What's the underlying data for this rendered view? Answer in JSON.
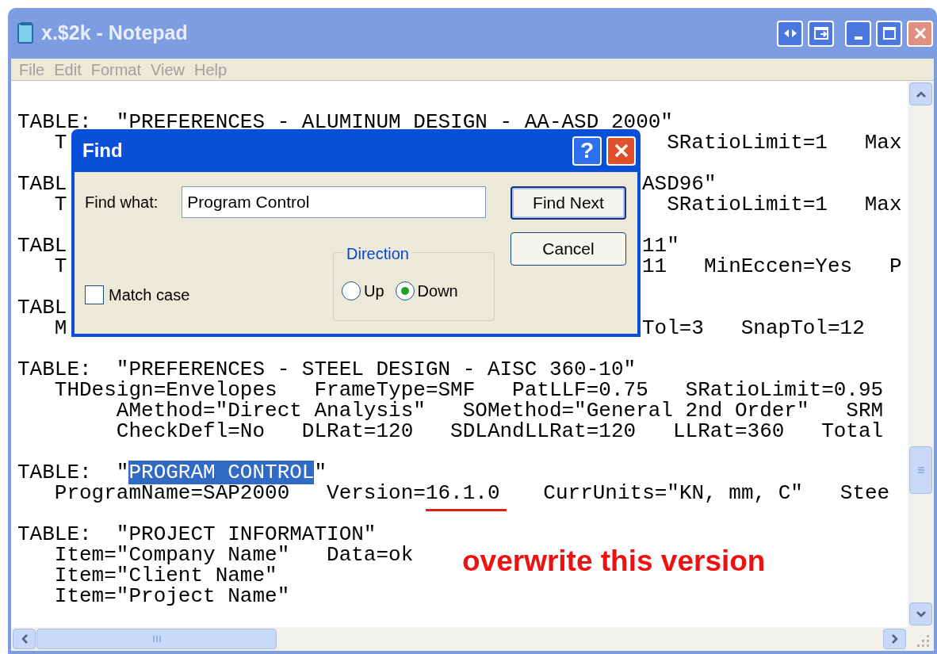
{
  "window": {
    "title": "x.$2k - Notepad"
  },
  "menu": [
    "File",
    "Edit",
    "Format",
    "View",
    "Help"
  ],
  "document": {
    "blocks": [
      {
        "lines": [
          {
            "segments": [
              {
                "kind": "plain",
                "text": "TABLE:  \"PREFERENCES - ALUMINUM DESIGN - AA-ASD 2000\""
              }
            ]
          },
          {
            "segments": [
              {
                "kind": "plain",
                "text": "   T"
              },
              {
                "kind": "far",
                "text": "  SRatioLimit=1   Max"
              }
            ]
          }
        ]
      },
      {
        "lines": [
          {
            "segments": [
              {
                "kind": "plain",
                "text": "TABL"
              },
              {
                "kind": "far",
                "text": "ASD96\""
              }
            ]
          },
          {
            "segments": [
              {
                "kind": "plain",
                "text": "   T"
              },
              {
                "kind": "far",
                "text": "  SRatioLimit=1   Max"
              }
            ]
          }
        ]
      },
      {
        "lines": [
          {
            "segments": [
              {
                "kind": "plain",
                "text": "TABL"
              },
              {
                "kind": "far",
                "text": "11\""
              }
            ]
          },
          {
            "segments": [
              {
                "kind": "plain",
                "text": "   T"
              },
              {
                "kind": "far",
                "text": "11   MinEccen=Yes   P"
              }
            ]
          }
        ]
      },
      {
        "lines": [
          {
            "segments": [
              {
                "kind": "plain",
                "text": "TABL"
              }
            ]
          },
          {
            "segments": [
              {
                "kind": "plain",
                "text": "   M"
              },
              {
                "kind": "far",
                "text": "Tol=3   SnapTol=12"
              }
            ]
          }
        ]
      },
      {
        "lines": [
          {
            "segments": [
              {
                "kind": "plain",
                "text": "TABLE:  \"PREFERENCES - STEEL DESIGN - AISC 360-10\""
              }
            ]
          },
          {
            "segments": [
              {
                "kind": "plain",
                "text": "   THDesign=Envelopes   FrameType=SMF   PatLLF=0.75   SRatioLimit=0.95"
              }
            ]
          },
          {
            "segments": [
              {
                "kind": "plain",
                "text": "        AMethod=\"Direct Analysis\"   SOMethod=\"General 2nd Order\"   SRM"
              }
            ]
          },
          {
            "segments": [
              {
                "kind": "plain",
                "text": "        CheckDefl=No   DLRat=120   SDLAndLLRat=120   LLRat=360   Total"
              }
            ]
          }
        ]
      },
      {
        "lines": [
          {
            "segments": [
              {
                "kind": "plain",
                "text": "TABLE:  \""
              },
              {
                "kind": "selected",
                "text": "PROGRAM CONTROL"
              },
              {
                "kind": "plain",
                "text": "\""
              }
            ]
          },
          {
            "segments": [
              {
                "kind": "plain",
                "text": "   ProgramName=SAP2000   Version="
              },
              {
                "kind": "marked",
                "text": "16.1.0"
              },
              {
                "kind": "plain",
                "text": "   CurrUnits=\"KN, mm, C\"   Stee"
              }
            ]
          }
        ]
      },
      {
        "lines": [
          {
            "segments": [
              {
                "kind": "plain",
                "text": "TABLE:  \"PROJECT INFORMATION\""
              }
            ]
          },
          {
            "segments": [
              {
                "kind": "plain",
                "text": "   Item=\"Company Name\"   Data=ok"
              }
            ]
          },
          {
            "segments": [
              {
                "kind": "plain",
                "text": "   Item=\"Client Name\""
              }
            ]
          },
          {
            "segments": [
              {
                "kind": "plain",
                "text": "   Item=\"Project Name\""
              }
            ]
          }
        ]
      }
    ]
  },
  "annotation": {
    "text": "overwrite this version"
  },
  "find_dialog": {
    "title": "Find",
    "help": "?",
    "find_what_label": "Find what:",
    "find_what_value": "Program Control",
    "buttons": [
      {
        "label": "Find Next",
        "default": true
      },
      {
        "label": "Cancel",
        "default": false
      }
    ],
    "direction": {
      "label": "Direction",
      "options": [
        {
          "label": "Up",
          "selected": false
        },
        {
          "label": "Down",
          "selected": true
        }
      ]
    },
    "match_case": {
      "label": "Match case",
      "checked": false
    }
  }
}
